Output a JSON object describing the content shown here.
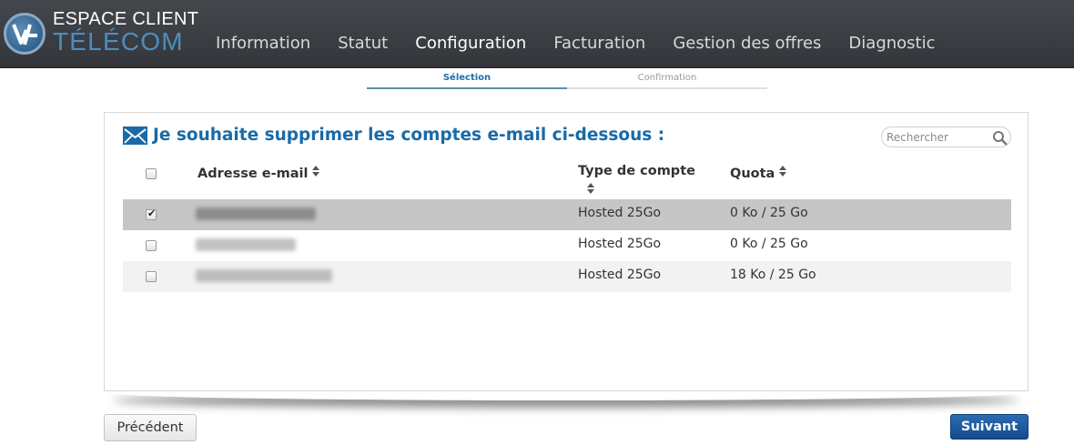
{
  "header": {
    "logo_line1": "ESPACE CLIENT",
    "logo_line2": "TÉLÉCOM",
    "nav": [
      {
        "label": "Information"
      },
      {
        "label": "Statut"
      },
      {
        "label": "Configuration",
        "active": true
      },
      {
        "label": "Facturation"
      },
      {
        "label": "Gestion des offres"
      },
      {
        "label": "Diagnostic"
      }
    ]
  },
  "steps": [
    {
      "label": "Sélection",
      "active": true
    },
    {
      "label": "Confirmation",
      "active": false
    }
  ],
  "panel": {
    "icon": "envelope-icon",
    "title": "Je souhaite supprimer les comptes e-mail ci-dessous :",
    "search_placeholder": "Rechercher",
    "columns": {
      "address": "Adresse e-mail",
      "type": "Type de compte",
      "quota": "Quota"
    },
    "rows": [
      {
        "checked": true,
        "email": "",
        "type": "Hosted 25Go",
        "quota": "0 Ko / 25 Go"
      },
      {
        "checked": false,
        "email": "",
        "type": "Hosted 25Go",
        "quota": "0 Ko / 25 Go"
      },
      {
        "checked": false,
        "email": "",
        "type": "Hosted 25Go",
        "quota": "18 Ko / 25 Go"
      }
    ]
  },
  "buttons": {
    "previous": "Précédent",
    "next": "Suivant"
  },
  "colors": {
    "accent": "#1a6aa6",
    "header_bg": "#3c3f44",
    "selected_row": "#c6c6c6",
    "primary_button": "#1d5a9e"
  }
}
